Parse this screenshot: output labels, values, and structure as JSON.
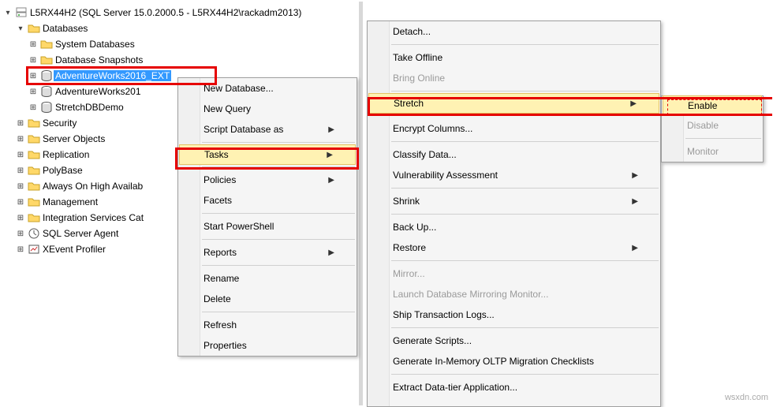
{
  "tree": {
    "server": "L5RX44H2 (SQL Server 15.0.2000.5 - L5RX44H2\\rackadm2013)",
    "databases": "Databases",
    "sysdb": "System Databases",
    "dbsnap": "Database Snapshots",
    "aw2016": "AdventureWorks2016_EXT",
    "aw201": "AdventureWorks201",
    "stretchdemo": "StretchDBDemo",
    "security": "Security",
    "serverobj": "Server Objects",
    "replication": "Replication",
    "polybase": "PolyBase",
    "alwayson": "Always On High Availab",
    "management": "Management",
    "intsvc": "Integration Services Cat",
    "agent": "SQL Server Agent",
    "xevent": "XEvent Profiler"
  },
  "menu1": {
    "newdb": "New Database...",
    "newq": "New Query",
    "script": "Script Database as",
    "tasks": "Tasks",
    "policies": "Policies",
    "facets": "Facets",
    "startps": "Start PowerShell",
    "reports": "Reports",
    "rename": "Rename",
    "delete": "Delete",
    "refresh": "Refresh",
    "props": "Properties"
  },
  "menu2": {
    "detach": "Detach...",
    "offline": "Take Offline",
    "online": "Bring Online",
    "stretch": "Stretch",
    "encrypt": "Encrypt Columns...",
    "classify": "Classify Data...",
    "vuln": "Vulnerability Assessment",
    "shrink": "Shrink",
    "backup": "Back Up...",
    "restore": "Restore",
    "mirror": "Mirror...",
    "launchmm": "Launch Database Mirroring Monitor...",
    "shiplogs": "Ship Transaction Logs...",
    "genscripts": "Generate Scripts...",
    "genoltp": "Generate In-Memory OLTP Migration Checklists",
    "extract": "Extract Data-tier Application..."
  },
  "menu3": {
    "enable": "Enable",
    "disable": "Disable",
    "monitor": "Monitor"
  },
  "watermark": "wsxdn.com"
}
